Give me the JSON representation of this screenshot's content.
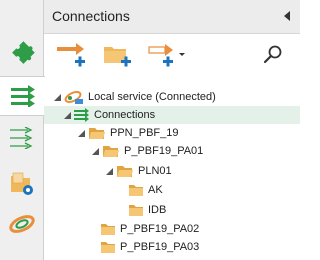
{
  "panel": {
    "title": "Connections"
  },
  "toolbar": {
    "buttons": [
      {
        "name": "add-connection",
        "icon": "arrow-plus-icon"
      },
      {
        "name": "add-folder",
        "icon": "folder-plus-icon"
      },
      {
        "name": "add-dropdown",
        "icon": "arrow-plus-dropdown-icon"
      },
      {
        "name": "search",
        "icon": "search-icon"
      }
    ]
  },
  "sidebar": {
    "items": [
      {
        "name": "plugins",
        "icon": "puzzle-icon"
      },
      {
        "name": "connections",
        "icon": "green-arrows-icon",
        "active": true
      },
      {
        "name": "transfers",
        "icon": "outline-arrows-icon"
      },
      {
        "name": "settings",
        "icon": "folder-gear-icon"
      },
      {
        "name": "sync",
        "icon": "link-ring-icon"
      }
    ]
  },
  "tree": {
    "items": [
      {
        "label": "Local service (Connected)",
        "level": 0,
        "expanded": true
      },
      {
        "label": "Connections",
        "level": 1,
        "expanded": true,
        "selected": true
      },
      {
        "label": "PPN_PBF_19",
        "level": 2,
        "expanded": true
      },
      {
        "label": "P_PBF19_PA01",
        "level": 3,
        "expanded": true
      },
      {
        "label": "PLN01",
        "level": 4,
        "expanded": true
      },
      {
        "label": "AK",
        "level": 5
      },
      {
        "label": "IDB",
        "level": 5
      },
      {
        "label": "P_PBF19_PA02",
        "level": 3
      },
      {
        "label": "P_PBF19_PA03",
        "level": 3
      }
    ]
  },
  "colors": {
    "accent_green": "#2e9d47",
    "folder": "#f0b75b",
    "arrow_orange": "#e98e3a",
    "plus_blue": "#1e73be"
  }
}
